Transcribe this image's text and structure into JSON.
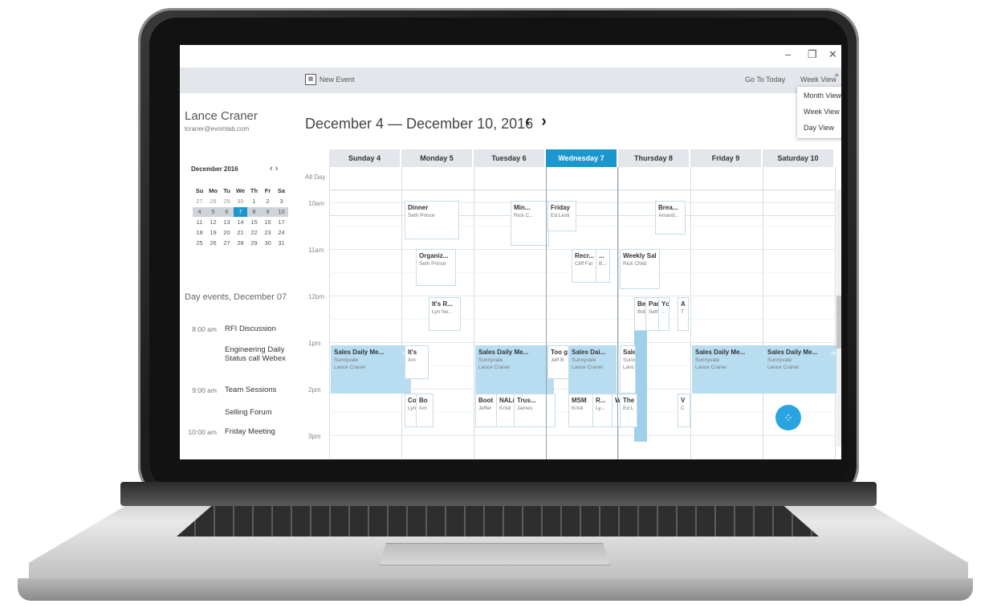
{
  "window": {
    "minimize": "–",
    "restore": "❐",
    "close": "✕"
  },
  "toolbar": {
    "new_event": "New Event",
    "go_today": "Go To Today",
    "view_select": "Week View"
  },
  "view_menu": {
    "items": [
      "Month View",
      "Week View",
      "Day View"
    ]
  },
  "user": {
    "name": "Lance Craner",
    "email": "lcraner@evomlab.com"
  },
  "mini_calendar": {
    "title": "December 2016",
    "nav": "‹ ›",
    "weekdays": [
      "Su",
      "Mo",
      "Tu",
      "We",
      "Th",
      "Fr",
      "Sa"
    ],
    "weeks": [
      [
        "27",
        "28",
        "29",
        "30",
        "1",
        "2",
        "3"
      ],
      [
        "4",
        "5",
        "6",
        "7",
        "8",
        "9",
        "10"
      ],
      [
        "11",
        "12",
        "13",
        "14",
        "15",
        "16",
        "17"
      ],
      [
        "18",
        "19",
        "20",
        "21",
        "22",
        "23",
        "24"
      ],
      [
        "25",
        "26",
        "27",
        "28",
        "29",
        "30",
        "31"
      ]
    ]
  },
  "day_events": {
    "title": "Day events, December 07",
    "items": [
      {
        "time": "8:00 am",
        "title": "RFI Discussion"
      },
      {
        "time": "",
        "title": "Engineering Daily Status call Webex"
      },
      {
        "time": "9:00 am",
        "title": "Team Sessions"
      },
      {
        "time": "",
        "title": "Selling Forum"
      },
      {
        "time": "10:00 am",
        "title": "Friday Meeting"
      }
    ]
  },
  "calendar": {
    "range": "December 4 — December 10, 2016",
    "arrows": "‹ ›",
    "all_day": "All Day",
    "days": [
      "Sunday 4",
      "Monday 5",
      "Tuesday 6",
      "Wednesday 7",
      "Thursday 8",
      "Friday 9",
      "Saturday 10"
    ],
    "times": [
      "10am",
      "11am",
      "12pm",
      "1pm",
      "2pm",
      "3pm"
    ],
    "events": [
      {
        "title": "Dinner",
        "sub": "Seth Prince"
      },
      {
        "title": "Min...",
        "sub": "Rick C..."
      },
      {
        "title": "Friday",
        "sub": "Ed Lesti"
      },
      {
        "title": "Brea...",
        "sub": "Amand..."
      },
      {
        "title": "Organiz...",
        "sub": "Seth Prince"
      },
      {
        "title": "Recr...",
        "sub": "Cliff Fal"
      },
      {
        "title": "...",
        "sub": "B..."
      },
      {
        "title": "Weekly Sal",
        "sub": "Rick Child"
      },
      {
        "title": "It's R...",
        "sub": "Lyn Ne..."
      },
      {
        "title": "Ben",
        "sub": "Bob"
      },
      {
        "title": "Par",
        "sub": "Seth"
      },
      {
        "title": "Yc",
        "sub": "..."
      },
      {
        "title": "A",
        "sub": "T"
      },
      {
        "title": "Sales Daily Me...",
        "sub": "Sunnyvale",
        "sub2": "Lance Craner"
      },
      {
        "title": "It's",
        "sub": "Am"
      },
      {
        "title": "Sales Daily Me...",
        "sub": "Sunnyvale",
        "sub2": "Lance Craner"
      },
      {
        "title": "Too g",
        "sub": "Jeff B"
      },
      {
        "title": "Sales Dai...",
        "sub": "Sunnyvale",
        "sub2": "Lance Craner"
      },
      {
        "title": "Sale",
        "sub": "Sunn",
        "sub2": "Lanc"
      },
      {
        "title": "Sales Daily Me...",
        "sub": "Sunnyvale",
        "sub2": "Lance Craner"
      },
      {
        "title": "Sales Daily Me...",
        "sub": "Sunnyvale",
        "sub2": "Lance Craner"
      },
      {
        "title": "Co",
        "sub": "Lyn"
      },
      {
        "title": "Bo",
        "sub": "Am"
      },
      {
        "title": "Boot",
        "sub": "Jeffer"
      },
      {
        "title": "NAL/",
        "sub": "Kristi"
      },
      {
        "title": "Trus...",
        "sub": "James"
      },
      {
        "title": "MSM",
        "sub": "Kristi"
      },
      {
        "title": "R...",
        "sub": "Ly..."
      },
      {
        "title": "W",
        "sub": ""
      },
      {
        "title": "The",
        "sub": "Ed L"
      },
      {
        "title": "V",
        "sub": "C"
      }
    ]
  },
  "fab": {
    "icon": "blackberry-icon",
    "glyph": "⁘"
  }
}
